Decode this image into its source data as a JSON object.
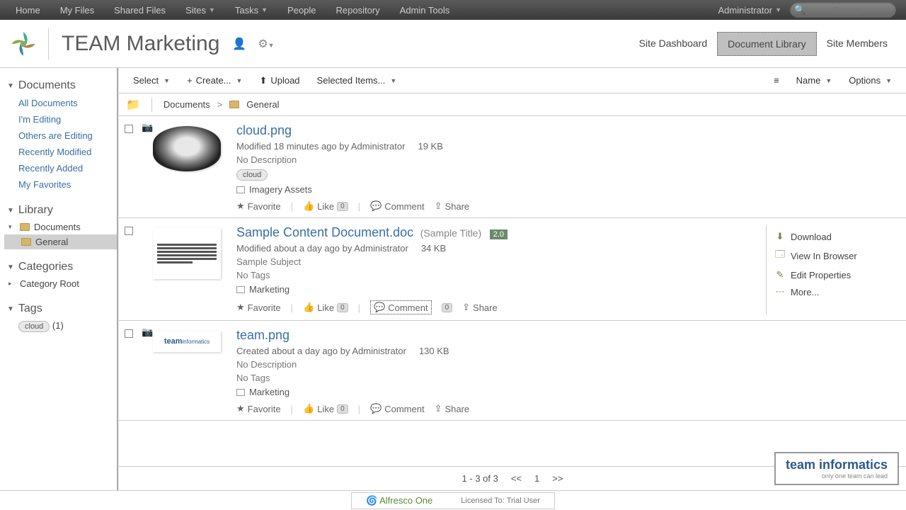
{
  "topnav": {
    "items": [
      "Home",
      "My Files",
      "Shared Files",
      "Sites",
      "Tasks",
      "People",
      "Repository",
      "Admin Tools"
    ],
    "user": "Administrator",
    "search_placeholder": "Search..."
  },
  "site": {
    "title": "TEAM Marketing",
    "nav": [
      "Site Dashboard",
      "Document Library",
      "Site Members"
    ],
    "active_nav": 1
  },
  "sidebar": {
    "documents_hd": "Documents",
    "doc_links": [
      "All Documents",
      "I'm Editing",
      "Others are Editing",
      "Recently Modified",
      "Recently Added",
      "My Favorites"
    ],
    "library_hd": "Library",
    "library_root": "Documents",
    "library_child": "General",
    "categories_hd": "Categories",
    "category_root": "Category Root",
    "tags_hd": "Tags",
    "tag_name": "cloud",
    "tag_count": "(1)"
  },
  "toolbar": {
    "select": "Select",
    "create": "Create...",
    "upload": "Upload",
    "selected": "Selected Items...",
    "sort_name": "Name",
    "options": "Options"
  },
  "breadcrumb": {
    "root": "Documents",
    "current": "General"
  },
  "docs": [
    {
      "name": "cloud.png",
      "meta": "Modified 18 minutes ago by Administrator",
      "size": "19 KB",
      "desc": "No Description",
      "tag": "cloud",
      "category": "Imagery Assets",
      "has_camera": true,
      "thumb_type": "cloud"
    },
    {
      "name": "Sample Content Document.doc",
      "subtitle": "(Sample Title)",
      "version": "2.0",
      "meta": "Modified about a day ago by Administrator",
      "size": "34 KB",
      "desc": "Sample Subject",
      "notags": "No Tags",
      "category": "Marketing",
      "thumb_type": "doc",
      "hovered": true
    },
    {
      "name": "team.png",
      "meta": "Created about a day ago by Administrator",
      "size": "130 KB",
      "desc": "No Description",
      "notags": "No Tags",
      "category": "Marketing",
      "has_camera": true,
      "thumb_type": "team"
    }
  ],
  "row_actions": {
    "favorite": "Favorite",
    "like": "Like",
    "like_count": "0",
    "comment": "Comment",
    "share": "Share"
  },
  "hover_actions": [
    "Download",
    "View In Browser",
    "Edit Properties",
    "More..."
  ],
  "pager": {
    "summary": "1 - 3 of 3",
    "prev": "<<",
    "page": "1",
    "next": ">>"
  },
  "footer": {
    "product": "Alfresco One",
    "license": "Licensed To: Trial User"
  },
  "corner": {
    "brand": "team informatics",
    "tagline": "only one team can lead"
  }
}
